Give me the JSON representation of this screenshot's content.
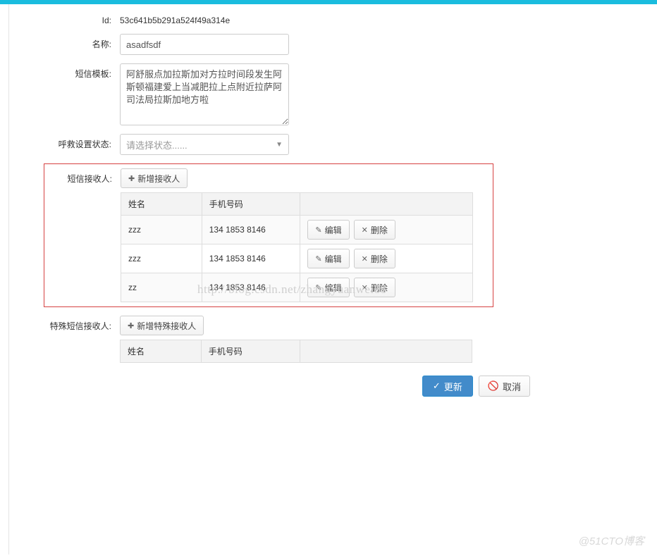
{
  "form": {
    "id_label": "Id:",
    "id_value": "53c641b5b291a524f49a314e",
    "name_label": "名称:",
    "name_value": "asadfsdf",
    "template_label": "短信模板:",
    "template_value": "阿舒服点加拉斯加对方拉时间段发生阿斯顿福建爱上当减肥拉上点附近拉萨阿司法局拉斯加地方啦",
    "status_label": "呼救设置状态:",
    "status_placeholder": "请选择状态......"
  },
  "recipients": {
    "label": "短信接收人:",
    "add_button": "新增接收人",
    "columns": {
      "name": "姓名",
      "phone": "手机号码"
    },
    "actions": {
      "edit": "编辑",
      "delete": "删除"
    },
    "rows": [
      {
        "name": "zzz",
        "phone": "134 1853 8146"
      },
      {
        "name": "zzz",
        "phone": "134 1853 8146"
      },
      {
        "name": "zz",
        "phone": "134 1853 8146"
      }
    ]
  },
  "special_recipients": {
    "label": "特殊短信接收人:",
    "add_button": "新增特殊接收人",
    "columns": {
      "name": "姓名",
      "phone": "手机号码"
    }
  },
  "footer": {
    "update": "更新",
    "cancel": "取消"
  },
  "watermark": {
    "url": "http://blog.csdn.net/zhangyuanwei88",
    "footer": "@51CTO博客"
  }
}
